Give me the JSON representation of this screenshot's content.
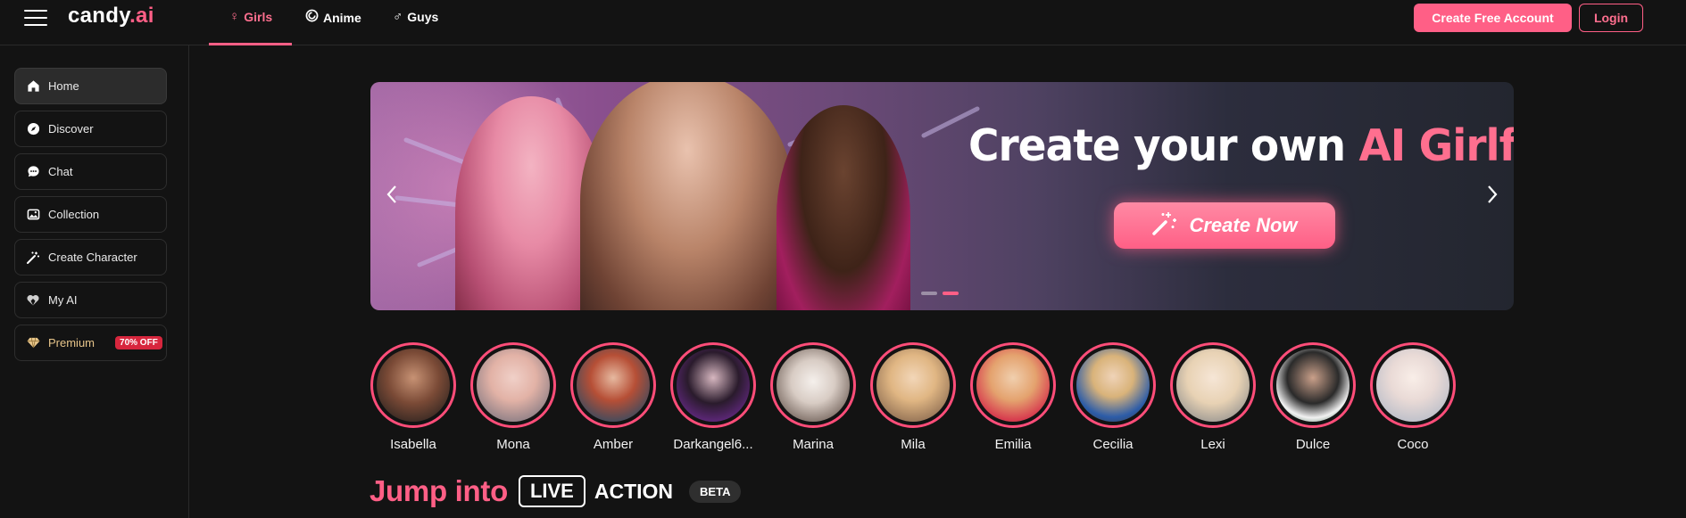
{
  "header": {
    "logo_main": "candy",
    "logo_ai": ".ai",
    "tabs": [
      {
        "label": "Girls",
        "icon": "female-symbol-icon"
      },
      {
        "label": "Anime",
        "icon": "anime-swirl-icon"
      },
      {
        "label": "Guys",
        "icon": "male-symbol-icon"
      }
    ],
    "create_account_label": "Create Free Account",
    "login_label": "Login"
  },
  "sidebar": {
    "items": [
      {
        "label": "Home",
        "icon": "home-icon"
      },
      {
        "label": "Discover",
        "icon": "compass-icon"
      },
      {
        "label": "Chat",
        "icon": "chat-bubble-icon"
      },
      {
        "label": "Collection",
        "icon": "gallery-icon"
      },
      {
        "label": "Create Character",
        "icon": "magic-wand-icon"
      },
      {
        "label": "My AI",
        "icon": "heart-hands-icon"
      },
      {
        "label": "Premium",
        "icon": "diamond-icon",
        "badge": "70% OFF"
      }
    ]
  },
  "banner": {
    "headline_white": "Create your own ",
    "headline_pink": "AI Girlfriend",
    "cta_label": "Create Now",
    "slide_count": 2,
    "active_slide": 2
  },
  "characters": [
    {
      "name": "Isabella"
    },
    {
      "name": "Mona"
    },
    {
      "name": "Amber"
    },
    {
      "name": "Darkangel6..."
    },
    {
      "name": "Marina"
    },
    {
      "name": "Mila"
    },
    {
      "name": "Emilia"
    },
    {
      "name": "Cecilia"
    },
    {
      "name": "Lexi"
    },
    {
      "name": "Dulce"
    },
    {
      "name": "Coco"
    }
  ],
  "jump": {
    "title": "Jump into",
    "live": "LIVE",
    "action": "ACTION",
    "beta": "BETA"
  },
  "colors": {
    "accent": "#ff5f86",
    "background": "#131313",
    "premium": "#e7c58a",
    "badge": "#d7263d"
  }
}
